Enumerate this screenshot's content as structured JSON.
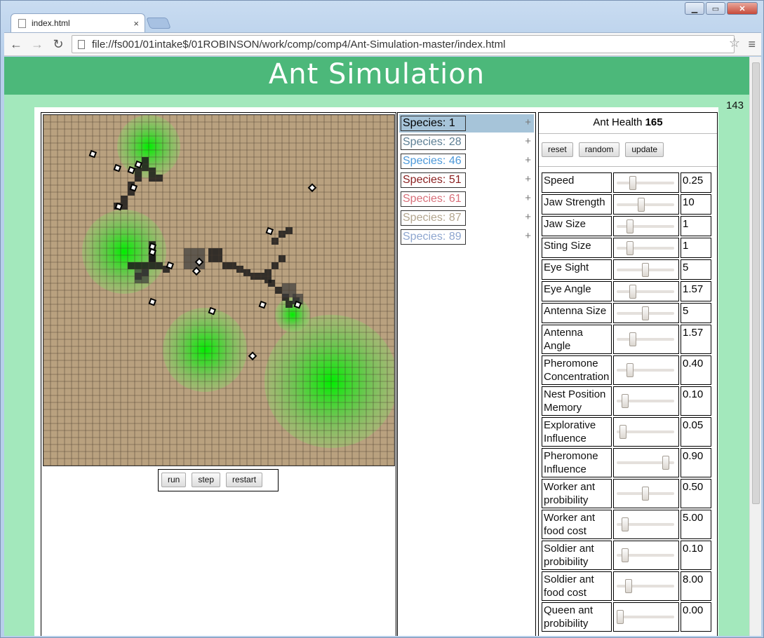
{
  "browser": {
    "tab_title": "index.html",
    "tab_close": "×",
    "url": "file://fs001/01intake$/01ROBINSON/work/comp/comp4/Ant-Simulation-master/index.html",
    "back": "←",
    "forward": "→",
    "reload": "↻",
    "star": "☆",
    "menu": "≡",
    "minimize": "▁",
    "maximize": "▭",
    "close": "✕"
  },
  "page": {
    "title": "Ant Simulation",
    "counter": "143"
  },
  "sim_controls": {
    "run": "run",
    "step": "step",
    "restart": "restart"
  },
  "species": [
    {
      "label": "Species: 1",
      "color": "#000000",
      "selected": true
    },
    {
      "label": "Species: 28",
      "color": "#5d7f94",
      "selected": false
    },
    {
      "label": "Species: 46",
      "color": "#4d99d9",
      "selected": false
    },
    {
      "label": "Species: 51",
      "color": "#8a1f1f",
      "selected": false
    },
    {
      "label": "Species: 61",
      "color": "#d9707a",
      "selected": false
    },
    {
      "label": "Species: 87",
      "color": "#b3a68f",
      "selected": false
    },
    {
      "label": "Species: 89",
      "color": "#8ea6cf",
      "selected": false
    }
  ],
  "species_plus": "+",
  "health": {
    "label": "Ant Health",
    "value": "165"
  },
  "actions": {
    "reset": "reset",
    "random": "random",
    "update": "update"
  },
  "params": [
    {
      "label": "Speed",
      "value": "0.25",
      "slider": 0.25
    },
    {
      "label": "Jaw Strength",
      "value": "10",
      "slider": 0.41
    },
    {
      "label": "Jaw Size",
      "value": "1",
      "slider": 0.2
    },
    {
      "label": "Sting Size",
      "value": "1",
      "slider": 0.2
    },
    {
      "label": "Eye Sight",
      "value": "5",
      "slider": 0.5
    },
    {
      "label": "Eye Angle",
      "value": "1.57",
      "slider": 0.25
    },
    {
      "label": "Antenna Size",
      "value": "5",
      "slider": 0.5
    },
    {
      "label": "Antenna Angle",
      "value": "1.57",
      "slider": 0.25
    },
    {
      "label": "Pheromone Concentration",
      "value": "0.40",
      "slider": 0.2
    },
    {
      "label": "Nest Position Memory",
      "value": "0.10",
      "slider": 0.1
    },
    {
      "label": "Explorative Influence",
      "value": "0.05",
      "slider": 0.05
    },
    {
      "label": "Pheromone Influence",
      "value": "0.90",
      "slider": 0.9
    },
    {
      "label": "Worker ant probibility",
      "value": "0.50",
      "slider": 0.5
    },
    {
      "label": "Worker ant food cost",
      "value": "5.00",
      "slider": 0.1
    },
    {
      "label": "Soldier ant probibility",
      "value": "0.10",
      "slider": 0.1
    },
    {
      "label": "Soldier ant food cost",
      "value": "8.00",
      "slider": 0.16
    },
    {
      "label": "Queen ant probibility",
      "value": "0.00",
      "slider": 0.0
    }
  ],
  "colors": {
    "header": "#4cb87a",
    "page_bg": "#a3e8bc",
    "ground": "#b9a17f",
    "food": "#00ee00",
    "trail": "#1a1a1a"
  }
}
